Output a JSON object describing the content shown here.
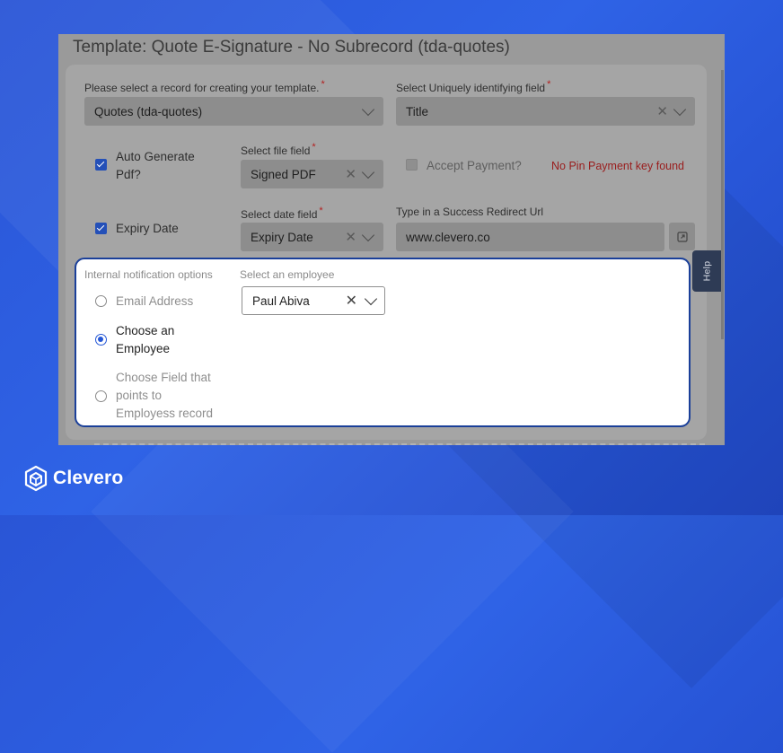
{
  "window_title": "Template: Quote E-Signature - No Subrecord (tda-quotes)",
  "record_select": {
    "label": "Please select a record for creating your template.",
    "required": "*",
    "value": "Quotes (tda-quotes)"
  },
  "unique_field": {
    "label": "Select Uniquely identifying field",
    "required": "*",
    "value": "Title"
  },
  "auto_pdf": {
    "label": "Auto Generate Pdf?",
    "checked": true
  },
  "file_field": {
    "label": "Select file field",
    "required": "*",
    "value": "Signed PDF"
  },
  "accept_payment": {
    "label": "Accept Payment?",
    "checked": false,
    "warning": "No Pin Payment key found"
  },
  "expiry": {
    "label": "Expiry Date",
    "checked": true
  },
  "date_field": {
    "label": "Select date field",
    "required": "*",
    "value": "Expiry Date"
  },
  "redirect": {
    "label": "Type in a Success Redirect Url",
    "value": "www.clevero.co"
  },
  "notification": {
    "label": "Internal notification options",
    "options": [
      {
        "label": "Email Address",
        "selected": false
      },
      {
        "label": "Choose an Employee",
        "selected": true
      },
      {
        "label": "Choose Field that points to Employess record",
        "selected": false
      }
    ],
    "employee_label": "Select an employee",
    "employee_value": "Paul Abiva"
  },
  "help_tab": "Help",
  "brand": "Clevero",
  "colors": {
    "accent": "#2457d6",
    "panel_border": "#1a3f99",
    "warning": "#9a1d1d",
    "background": "#2f63e6"
  }
}
